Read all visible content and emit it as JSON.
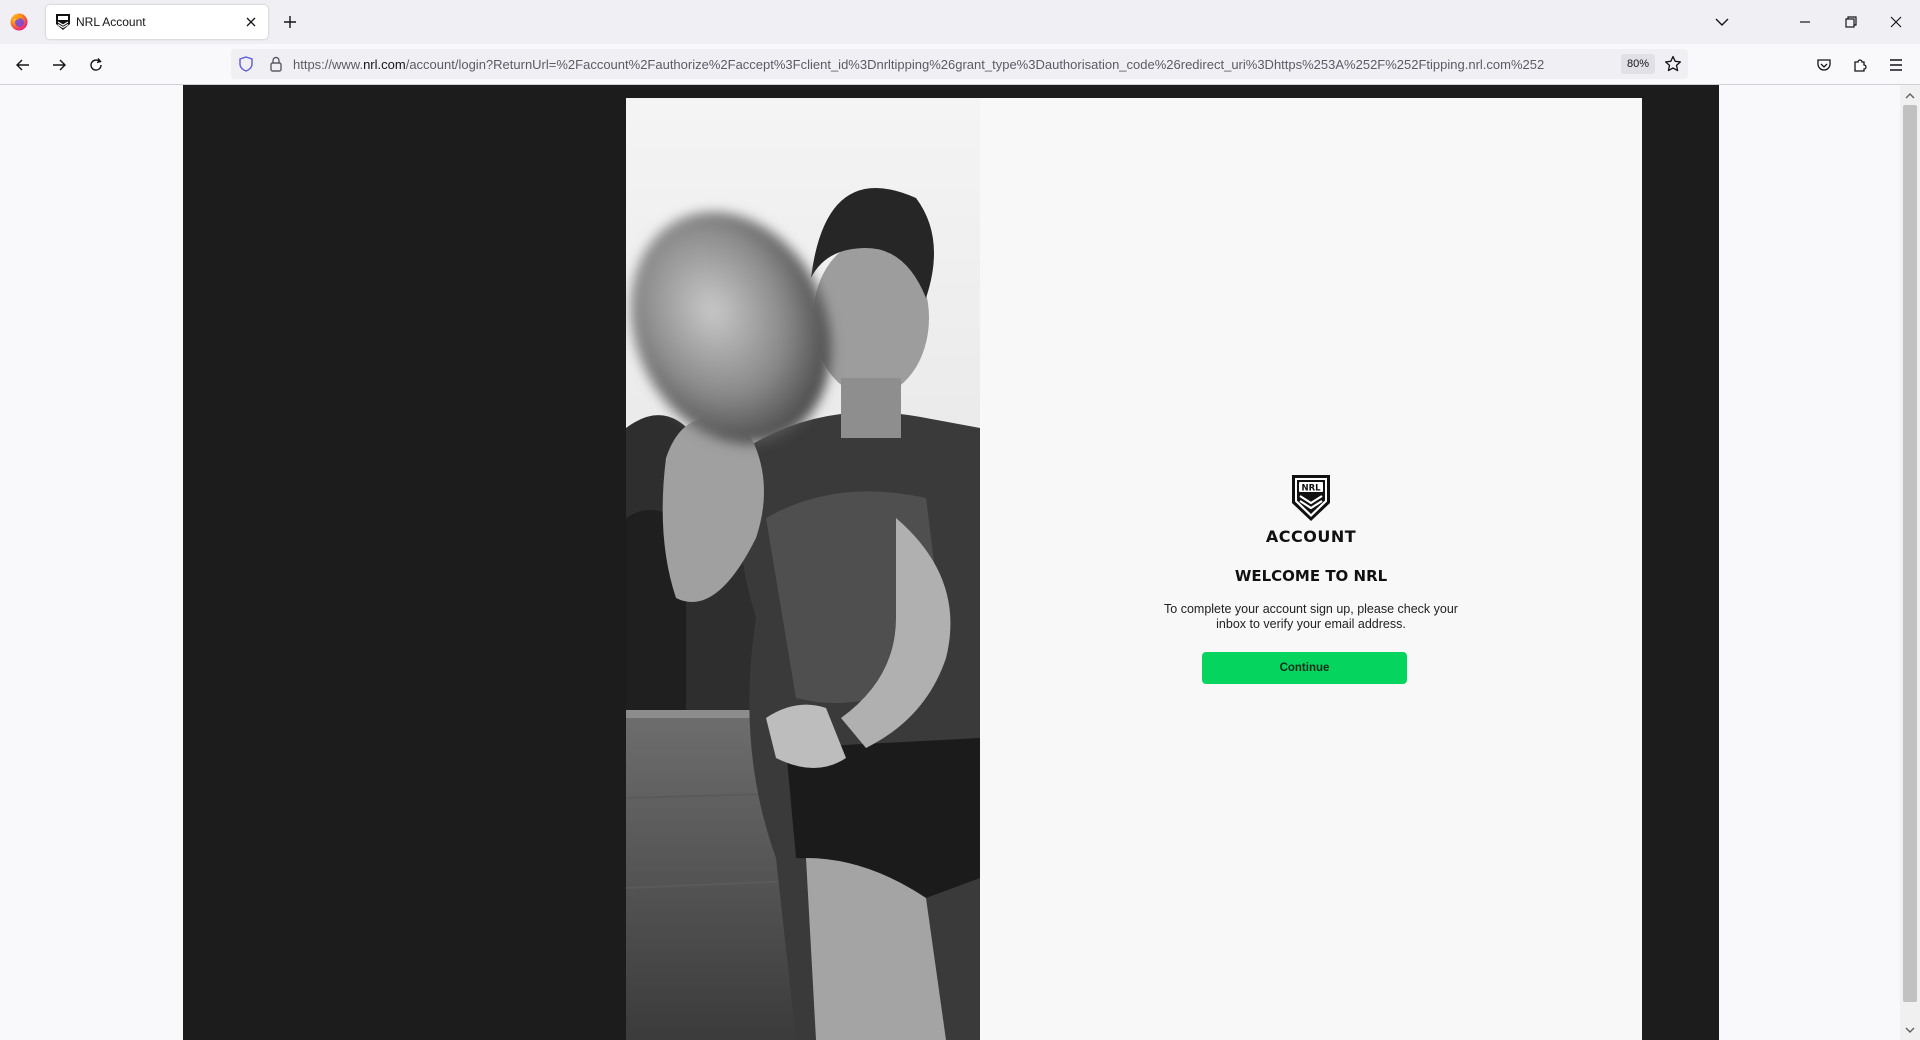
{
  "browser": {
    "tab_title": "NRL Account",
    "url_prefix": "https://www.",
    "url_host": "nrl.com",
    "url_path": "/account/login?ReturnUrl=%2Faccount%2Fauthorize%2Faccept%3Fclient_id%3Dnrltipping%26grant_type%3Dauthorisation_code%26redirect_uri%3Dhttps%253A%252F%252Ftipping.nrl.com%252",
    "zoom": "80%"
  },
  "icons": {
    "browser": "firefox-icon",
    "favicon": "nrl-shield-icon",
    "back": "arrow-left-icon",
    "forward": "arrow-right-icon",
    "reload": "reload-icon",
    "tracking": "shield-icon",
    "secure": "lock-icon",
    "bookmark": "star-icon",
    "pocket": "pocket-icon",
    "extensions": "puzzle-icon",
    "menu": "hamburger-icon"
  },
  "page": {
    "logo_text": "NRL",
    "brand_label": "ACCOUNT",
    "heading": "WELCOME TO NRL",
    "message": "To complete your account sign up, please check your inbox to verify your email address.",
    "continue_label": "Continue"
  },
  "colors": {
    "accent_green": "#05d45f",
    "backdrop": "#1c1c1c",
    "card": "#f8f8f8"
  }
}
